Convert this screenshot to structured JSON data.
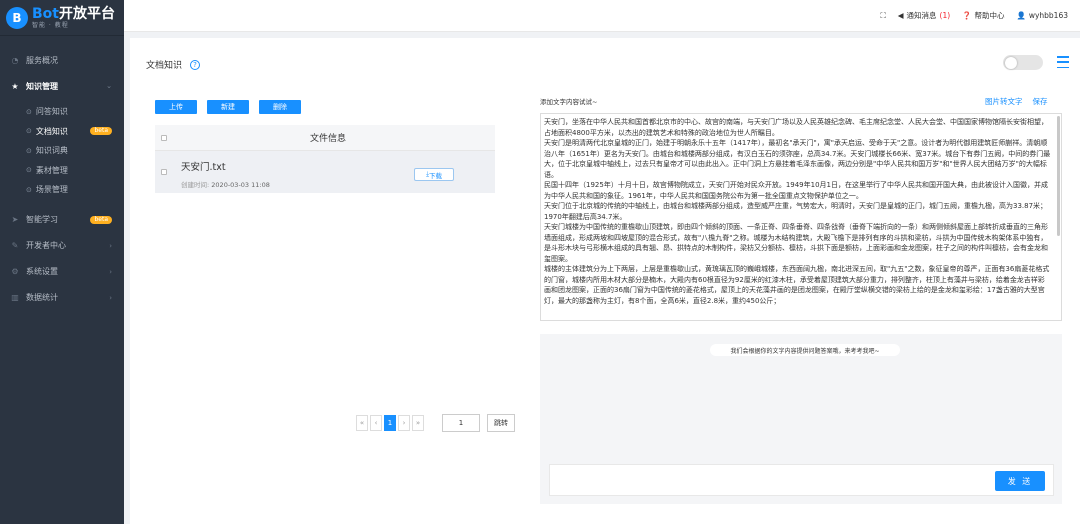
{
  "logo": {
    "initial": "B",
    "brand": "Bot",
    "title": "开放平台",
    "subtitle": "智能 · 教程"
  },
  "sidebar": {
    "items": [
      {
        "label": "服务概况"
      },
      {
        "label": "知识管理"
      },
      {
        "label": "问答知识"
      },
      {
        "label": "文档知识",
        "badge": "beta"
      },
      {
        "label": "知识词典"
      },
      {
        "label": "素材管理"
      },
      {
        "label": "场景管理"
      },
      {
        "label": "智能学习",
        "badge": "beta"
      },
      {
        "label": "开发者中心"
      },
      {
        "label": "系统设置"
      },
      {
        "label": "数据统计"
      }
    ]
  },
  "header": {
    "notify_label": "通知消息",
    "notify_count": "(1)",
    "help": "帮助中心",
    "user": "wyhbb163"
  },
  "page": {
    "title": "文档知识",
    "help_icon": "?"
  },
  "toolbar": {
    "upload": "上传",
    "create": "新建",
    "delete": "删除"
  },
  "file_table": {
    "header": "文件信息",
    "rows": [
      {
        "name": "天安门.txt",
        "date_label": "创建时间:",
        "date": "2020-03-03 11:08",
        "download": "下载"
      }
    ]
  },
  "pager": {
    "first": "«",
    "prev": "‹",
    "current": "1",
    "next": "›",
    "last": "»",
    "input": "1",
    "jump": "跳转"
  },
  "editor": {
    "label": "添加文字内容试试~",
    "ocr_link": "图片转文字",
    "save_link": "保存",
    "paragraphs": [
      "天安门，坐落在中华人民共和国首都北京市的中心、故宫的南端，与天安门广场以及人民英雄纪念碑、毛主席纪念堂、人民大会堂、中国国家博物馆隔长安街相望，占地面积4800平方米，以杰出的建筑艺术和特殊的政治地位为世人所瞩目。",
      "天安门是明清两代北京皇城的正门，始建于明朝永乐十五年（1417年），最初名\"承天门\"，寓\"承天启运、受命于天\"之意。设计者为明代御用建筑匠师蒯祥。清朝顺治八年（1651年）更名为天安门。由城台和城楼两部分组成，有汉白玉石的须弥座，总高34.7米。天安门城楼长66米、宽37米。城台下有券门五阙，中间的券门最大，位于北京皇城中轴线上，过去只有皇帝才可以由此出入。正中门洞上方悬挂着毛泽东画像，两边分别是\"中华人民共和国万岁\"和\"世界人民大团结万岁\"的大幅标语。",
      "民国十四年（1925年）十月十日，故宫博物院成立，天安门开始对民众开放。1949年10月1日，在这里举行了中华人民共和国开国大典，由此被设计入国徽，并成为中华人民共和国的象征。1961年，中华人民共和国国务院公布为第一批全国重点文物保护单位之一。",
      "天安门位于北京城的传统的中轴线上，由城台和城楼两部分组成，造型威严庄重，气势宏大，明清时，天安门是皇城的正门，城门五阙，重檐九楹，高为33.87米；1970年翻建后高34.7米。",
      "天安门城楼为中国传统的重檐歇山顶建筑，即由四个倾斜的顶面、一条正脊、四条垂脊、四条戗脊（垂脊下端折向的一条）和两侧倾斜屋面上部转折成垂直的三角形墙面组成，形成两坡和四坡屋顶的混合形式，故有\"八檐九脊\"之称。城楼为木结构建筑，大殿飞檐下是排列有序的斗拱和梁枋，斗拱为中国传统木构架体系中独有，是斗形木块与弓形横木组成的具有翘、昂、拱特点的木制构件，梁枋又分额枋、檩枋，斗拱下面是额枋，上面彩画和金龙图案，柱子之间的构件叫檩枋，会有金龙和玺图案。",
      "城楼的主体建筑分为上下两层，上层是重檐歇山式，黄琉璃瓦顶的巍峨城楼，东西面阔九楹，南北进深五间，取\"九五\"之数，象征皇帝的尊严，正面有36扇菱花格式的门窗，城楼内所用木材大部分是楠木，大殿内有60根直径为92厘米的红漆木柱，承受着屋顶建筑大部分重力，排列整齐，柱顶上有藻井与梁枋，绘着金龙吉祥彩画和团龙图案，正面的36扇门窗为中国传统的菱花格式，屋顶上的天花藻井画的是团龙图案，在殿厅堂纵横交错的梁枋上绘的是金龙和玺彩绘：17盏古雅的大型宫灯，最大的那盏称为主灯，有8个面，全高6米，直径2.8米，重约450公斤；"
    ]
  },
  "chat": {
    "bubble": "我们会根据你的文字内容提供问题答案哦，来考考我吧~",
    "send": "发 送"
  }
}
